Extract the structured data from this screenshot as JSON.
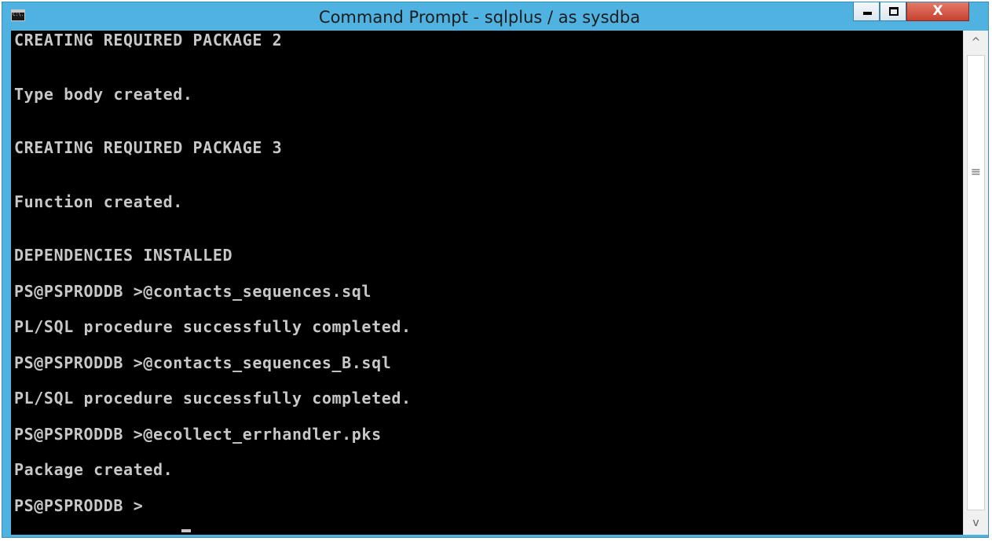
{
  "window": {
    "title": "Command Prompt - sqlplus  / as sysdba",
    "icon": "cmd-icon",
    "icon_text": "C:\\.",
    "controls": {
      "minimize_icon": "minimize-icon",
      "maximize_icon": "maximize-icon",
      "close_label": "X"
    }
  },
  "console": {
    "lines": [
      "CREATING REQUIRED PACKAGE 2",
      "Type body created.",
      "CREATING REQUIRED PACKAGE 3",
      "Function created.",
      "DEPENDENCIES INSTALLED",
      "PS@PSPRODDB >@contacts_sequences.sql",
      "PL/SQL procedure successfully completed.",
      "PS@PSPRODDB >@contacts_sequences_B.sql",
      "PL/SQL procedure successfully completed.",
      "PS@PSPRODDB >@ecollect_errhandler.pks",
      "Package created.",
      "PS@PSPRODDB >"
    ]
  },
  "scrollbar": {
    "up_arrow": "^",
    "down_arrow": "v",
    "grip": "≡"
  },
  "colors": {
    "titlebar": "#4fb2e0",
    "console_bg": "#000000",
    "console_fg": "#c8c8c8",
    "close_button": "#c7412e"
  }
}
